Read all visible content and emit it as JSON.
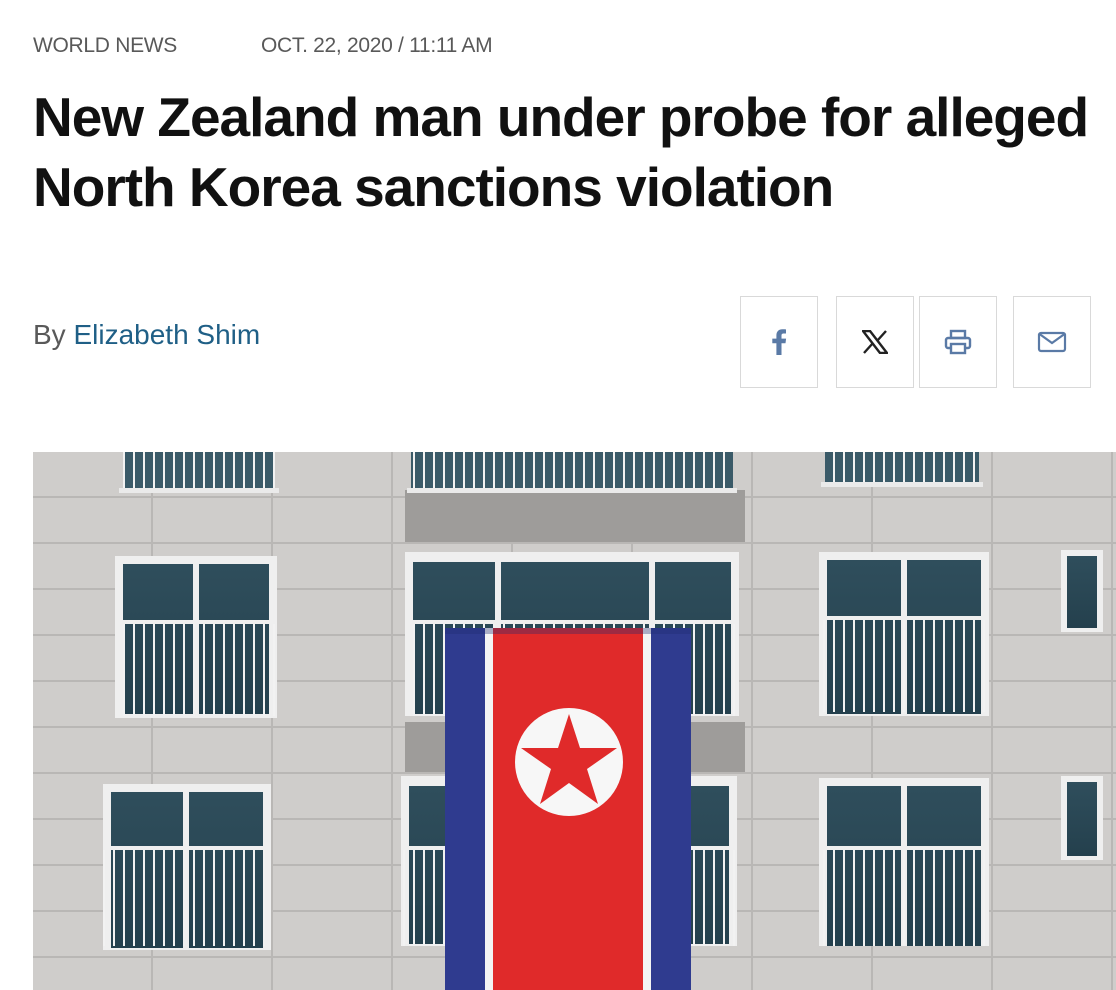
{
  "article": {
    "category": "WORLD NEWS",
    "date": "OCT. 22, 2020 / 11:11 AM",
    "headline": "New Zealand man under probe for alleged North Korea sanctions violation",
    "byline_prefix": "By",
    "author": "Elizabeth Shim"
  },
  "share": {
    "buttons": [
      {
        "icon": "facebook-icon"
      },
      {
        "icon": "x-icon"
      },
      {
        "icon": "print-icon"
      },
      {
        "icon": "mail-icon"
      }
    ]
  },
  "photo": {
    "subject": "north-korea-flag-on-building"
  },
  "colors": {
    "author_link": "#1f5f86",
    "icon": "#5a7aa6",
    "flag_blue": "#2f3b8f",
    "flag_red": "#e02a2a"
  }
}
